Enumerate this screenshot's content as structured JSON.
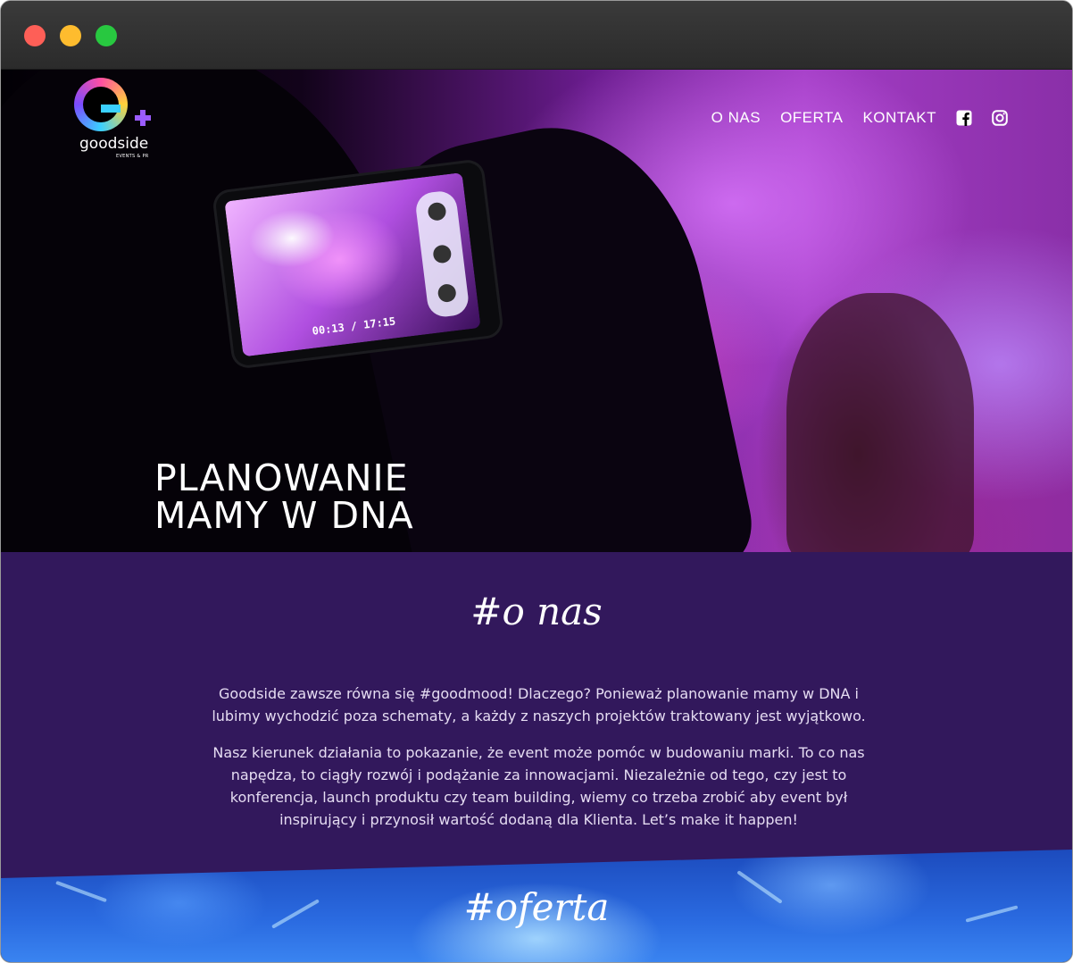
{
  "window": {
    "controls": [
      "close",
      "minimize",
      "zoom"
    ]
  },
  "brand": {
    "name": "goodside",
    "tagline": "EVENTS & PR"
  },
  "nav": {
    "items": [
      {
        "label": "O NAS"
      },
      {
        "label": "OFERTA"
      },
      {
        "label": "KONTAKT"
      }
    ],
    "social": [
      "facebook-icon",
      "instagram-icon"
    ]
  },
  "hero": {
    "phone_time": "00:13 / 17:15",
    "title_line1": "PLANOWANIE",
    "title_line2": "MAMY W DNA"
  },
  "about": {
    "title": "#o nas",
    "paragraphs": [
      "Goodside zawsze równa się #goodmood! Dlaczego? Ponieważ planowanie mamy w DNA i lubimy wychodzić poza schematy, a każdy z naszych projektów traktowany jest wyjątkowo.",
      "Nasz kierunek działania to pokazanie, że event może pomóc w budowaniu marki. To co nas napędza, to ciągły rozwój i podążanie za innowacjami. Niezależnie od tego, czy jest to konferencja, launch produktu czy team building, wiemy co trzeba zrobić aby event był inspirujący i przynosił wartość dodaną dla Klienta. Let’s make it happen!"
    ]
  },
  "offer": {
    "title": "#oferta"
  },
  "colors": {
    "about_bg": "#32185c",
    "offer_blue": "#2a6ae0",
    "hero_purple": "#a23cc4"
  }
}
